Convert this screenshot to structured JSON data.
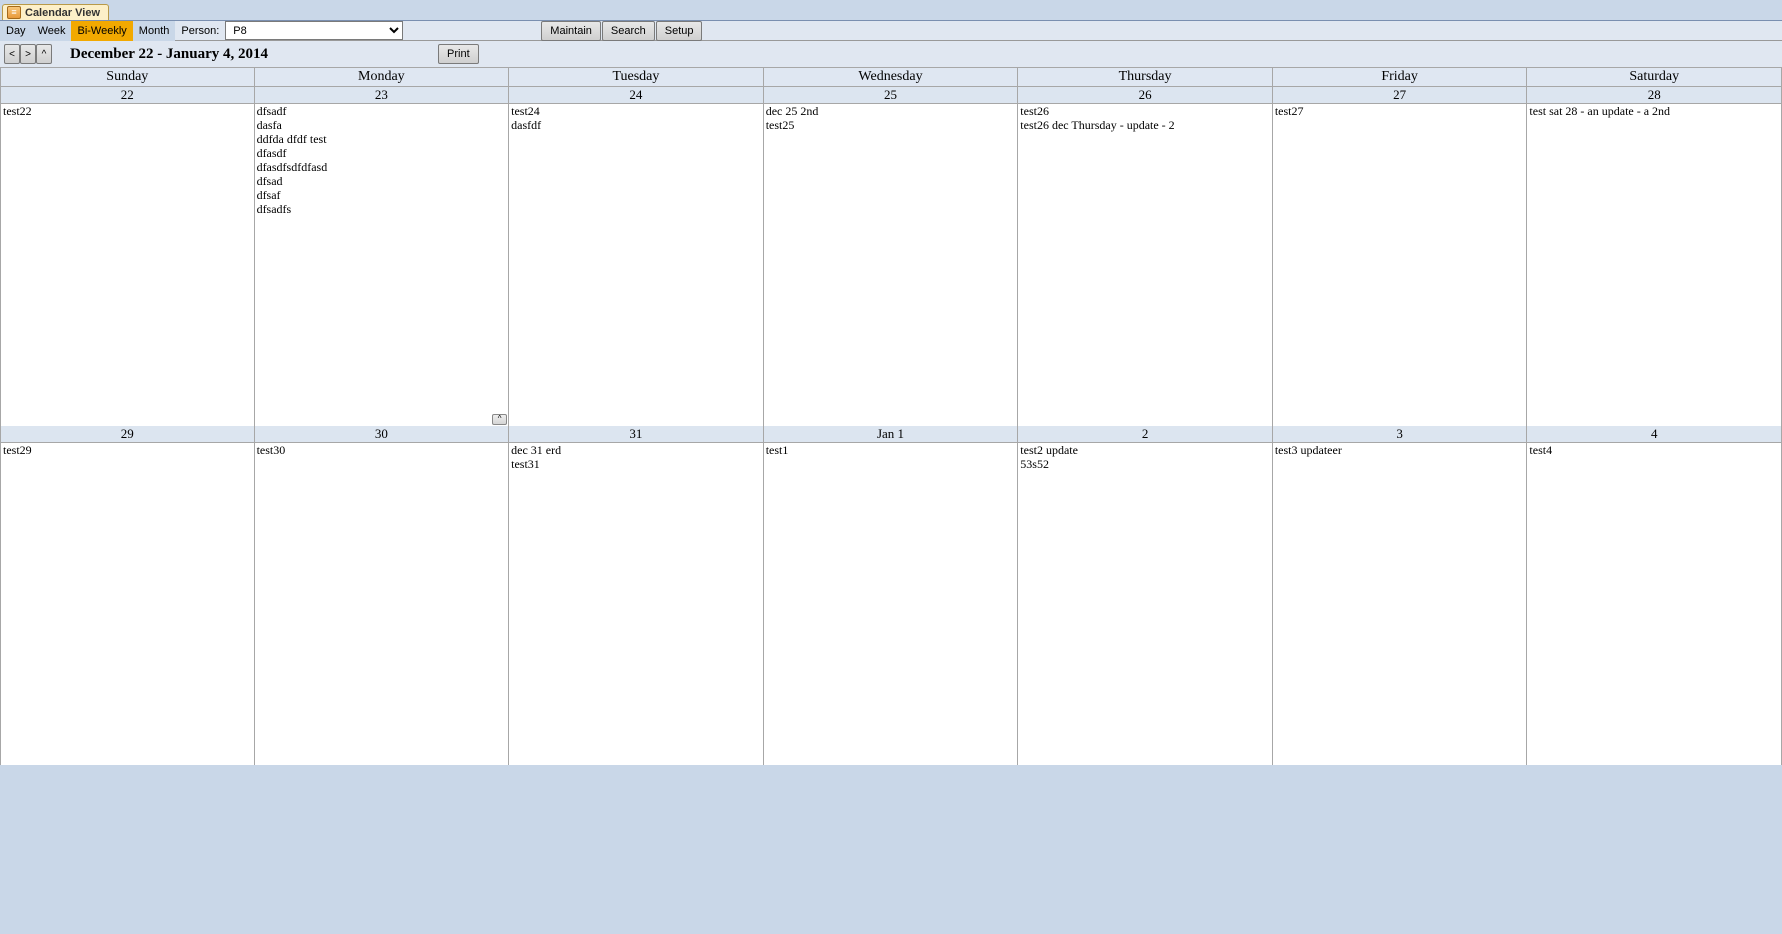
{
  "tab": {
    "title": "Calendar View"
  },
  "toolbar": {
    "views": [
      "Day",
      "Week",
      "Bi-Weekly",
      "Month"
    ],
    "active_view_index": 2,
    "person_label": "Person:",
    "person_value": "P8",
    "maintain": "Maintain",
    "search": "Search",
    "setup": "Setup"
  },
  "nav": {
    "prev": "<",
    "next": ">",
    "up": "^",
    "range": "December 22 - January 4, 2014",
    "print": "Print"
  },
  "day_headers": [
    "Sunday",
    "Monday",
    "Tuesday",
    "Wednesday",
    "Thursday",
    "Friday",
    "Saturday"
  ],
  "weeks": [
    {
      "dates": [
        "22",
        "23",
        "24",
        "25",
        "26",
        "27",
        "28"
      ],
      "events": [
        [
          "test22"
        ],
        [
          "dfsadf",
          "dasfa",
          "ddfda dfdf test",
          "dfasdf",
          "dfasdfsdfdfasd",
          "dfsad",
          "dfsaf",
          "dfsadfs"
        ],
        [
          "test24",
          "dasfdf"
        ],
        [
          "dec 25 2nd",
          "test25"
        ],
        [
          "test26",
          "test26 dec Thursday - update - 2"
        ],
        [
          "test27"
        ],
        [
          "test sat 28 - an update - a 2nd"
        ]
      ],
      "expand_index": 1
    },
    {
      "dates": [
        "29",
        "30",
        "31",
        "Jan 1",
        "2",
        "3",
        "4"
      ],
      "events": [
        [
          "test29"
        ],
        [
          "test30"
        ],
        [
          "dec 31 erd",
          "test31"
        ],
        [
          "test1"
        ],
        [
          "test2 update",
          "53s52"
        ],
        [
          "test3 updateer"
        ],
        [
          "test4"
        ]
      ],
      "expand_index": -1
    }
  ],
  "expand_glyph": "^"
}
